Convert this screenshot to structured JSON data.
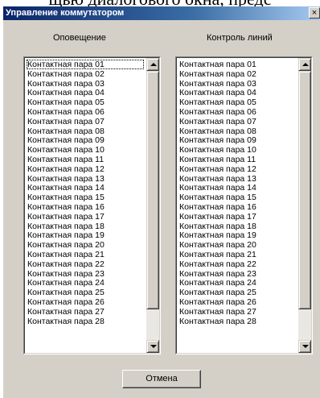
{
  "background_text": "щью диалогового окна, предс",
  "window": {
    "title": "Управление коммутатором",
    "close_label": "×"
  },
  "notify": {
    "label": "Оповещение",
    "items": [
      "Контактная пара 01",
      "Контактная пара 02",
      "Контактная пара 03",
      "Контактная пара 04",
      "Контактная пара 05",
      "Контактная пара 06",
      "Контактная пара 07",
      "Контактная пара 08",
      "Контактная пара 09",
      "Контактная пара 10",
      "Контактная пара 11",
      "Контактная пара 12",
      "Контактная пара 13",
      "Контактная пара 14",
      "Контактная пара 15",
      "Контактная пара 16",
      "Контактная пара 17",
      "Контактная пара 18",
      "Контактная пара 19",
      "Контактная пара 20",
      "Контактная пара 21",
      "Контактная пара 22",
      "Контактная пара 23",
      "Контактная пара 24",
      "Контактная пара 25",
      "Контактная пара 26",
      "Контактная пара 27",
      "Контактная пара 28"
    ],
    "scroll_position": 0
  },
  "line_control": {
    "label": "Контроль линий",
    "items": [
      "Контактная пара 01",
      "Контактная пара 02",
      "Контактная пара 03",
      "Контактная пара 04",
      "Контактная пара 05",
      "Контактная пара 06",
      "Контактная пара 07",
      "Контактная пара 08",
      "Контактная пара 09",
      "Контактная пара 10",
      "Контактная пара 11",
      "Контактная пара 12",
      "Контактная пара 13",
      "Контактная пара 14",
      "Контактная пара 15",
      "Контактная пара 16",
      "Контактная пара 17",
      "Контактная пара 18",
      "Контактная пара 19",
      "Контактная пара 20",
      "Контактная пара 21",
      "Контактная пара 22",
      "Контактная пара 23",
      "Контактная пара 24",
      "Контактная пара 25",
      "Контактная пара 26",
      "Контактная пара 27",
      "Контактная пара 28"
    ],
    "scroll_position": 0
  },
  "buttons": {
    "cancel": "Отмена"
  },
  "colors": {
    "face": "#d4d0c8",
    "title_start": "#0a246a",
    "title_end": "#a6caf0"
  },
  "icons": {
    "close": "close-icon",
    "scroll_up": "arrow-up-icon",
    "scroll_down": "arrow-down-icon"
  }
}
